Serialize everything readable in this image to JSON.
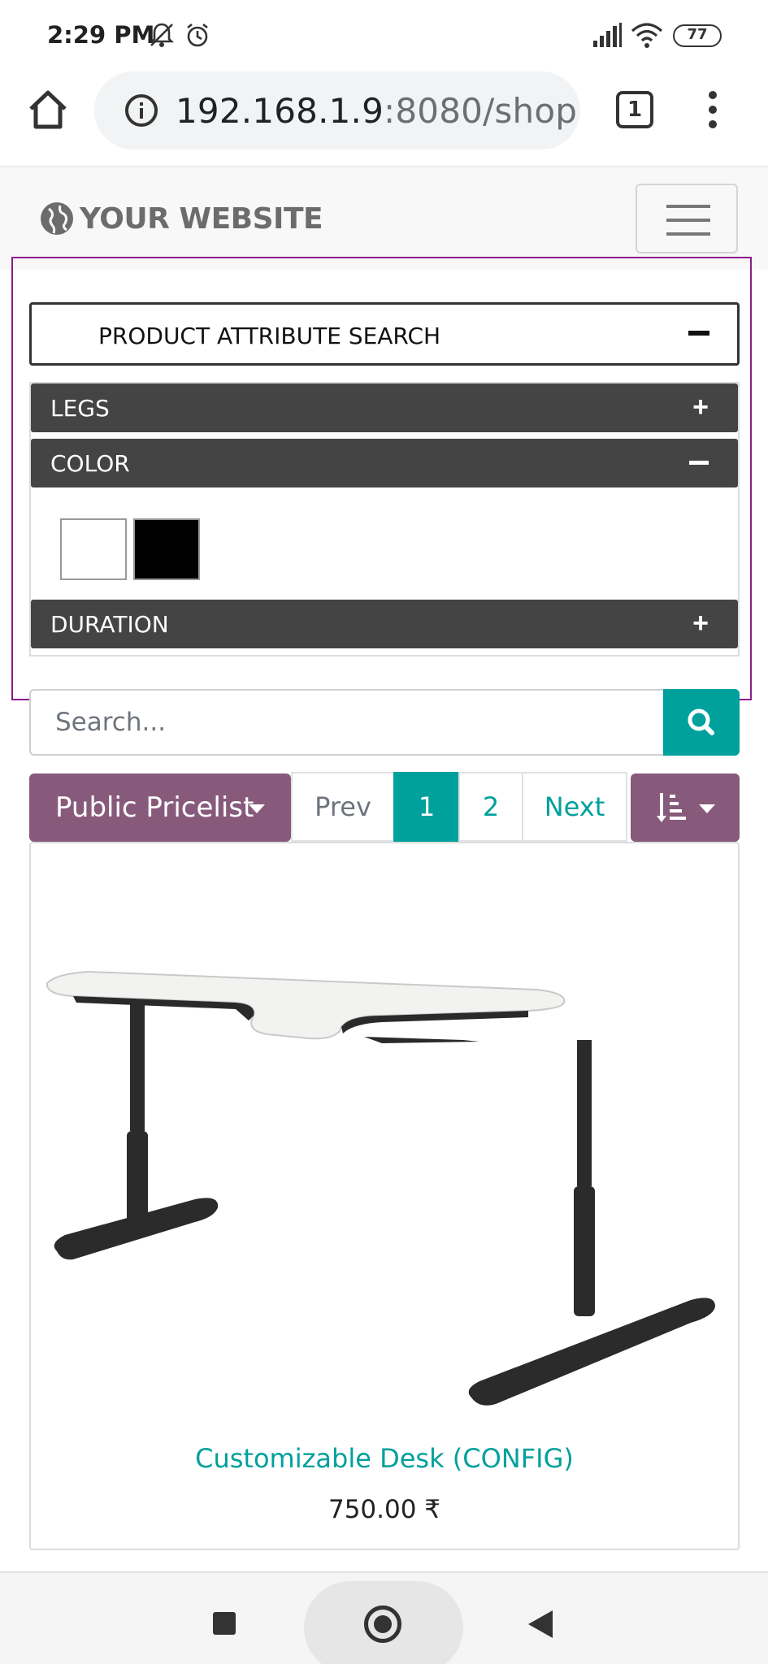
{
  "status_bar": {
    "time": "2:29 PM",
    "battery": "77"
  },
  "browser": {
    "url_host": "192.168.1.9",
    "url_path": ":8080/shop",
    "tab_count": "1"
  },
  "site": {
    "brand": "YOUR WEBSITE"
  },
  "attribute_search": {
    "title": "PRODUCT ATTRIBUTE SEARCH",
    "attributes": [
      {
        "label": "LEGS",
        "expanded": false
      },
      {
        "label": "COLOR",
        "expanded": true,
        "swatches": [
          "#ffffff",
          "#000000"
        ]
      },
      {
        "label": "DURATION",
        "expanded": false
      }
    ]
  },
  "search": {
    "placeholder": "Search..."
  },
  "toolbar": {
    "pricelist_label": "Public Pricelist",
    "pager": {
      "prev": "Prev",
      "pages": [
        "1",
        "2"
      ],
      "active_page": "1",
      "next": "Next"
    }
  },
  "products": [
    {
      "name": "Customizable Desk (CONFIG)",
      "price": "750.00 ₹"
    }
  ],
  "colors": {
    "primary": "#875a7b",
    "accent": "#00a09d",
    "attribute_bar": "#444444",
    "debug_outline": "#8b1c8b"
  }
}
